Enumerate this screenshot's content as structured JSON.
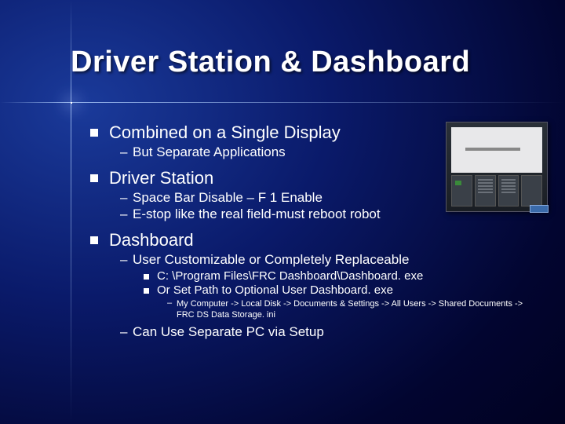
{
  "title": "Driver Station & Dashboard",
  "sections": [
    {
      "heading": "Combined on a Single Display",
      "sub": [
        {
          "text": "But Separate Applications"
        }
      ]
    },
    {
      "heading": "Driver Station",
      "sub": [
        {
          "text": "Space Bar Disable – F 1 Enable"
        },
        {
          "text": "E-stop like the real field-must reboot robot"
        }
      ]
    },
    {
      "heading": "Dashboard",
      "sub": [
        {
          "text": "User Customizable or Completely Replaceable",
          "sub": [
            {
              "text": "C: \\Program Files\\FRC Dashboard\\Dashboard. exe"
            },
            {
              "text": "Or Set Path to Optional User Dashboard. exe",
              "sub": [
                {
                  "text": "My Computer -> Local Disk -> Documents & Settings -> All Users -> Shared Documents -> FRC DS Data Storage. ini"
                }
              ]
            }
          ]
        },
        {
          "text": "Can Use Separate PC via Setup"
        }
      ]
    }
  ]
}
